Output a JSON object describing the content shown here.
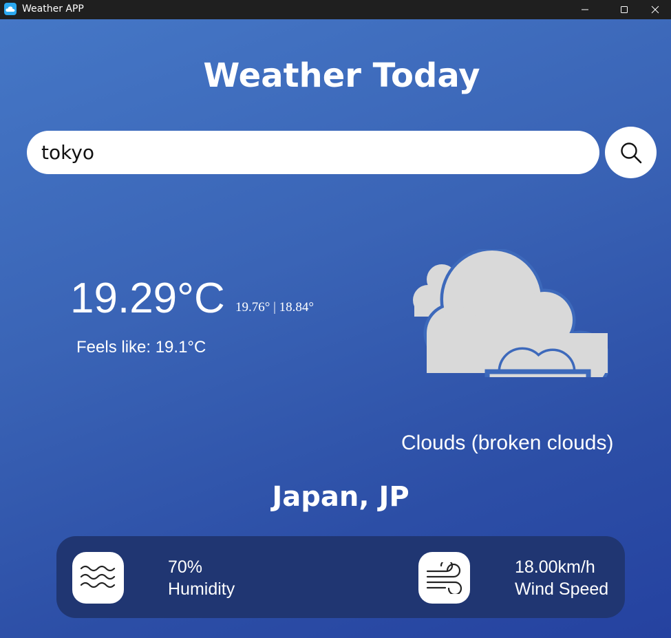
{
  "window": {
    "title": "Weather APP",
    "app_icon": "cloud-app-icon",
    "controls": [
      "minimize-icon",
      "maximize-icon",
      "close-icon"
    ]
  },
  "header": {
    "title": "Weather Today"
  },
  "search": {
    "value": "tokyo",
    "placeholder": "",
    "button_icon": "search-icon"
  },
  "current": {
    "temperature": "19.29°C",
    "range": "19.76° | 18.84°",
    "feels_like": "Feels like: 19.1°C",
    "condition_icon": "broken-clouds-icon",
    "description": "Clouds (broken clouds)",
    "location": "Japan, JP"
  },
  "stats": {
    "humidity": {
      "value": "70%",
      "label": "Humidity",
      "icon": "humidity-waves-icon"
    },
    "wind": {
      "value": "18.00km/h",
      "label": "Wind Speed",
      "icon": "wind-icon"
    }
  },
  "colors": {
    "background_top": "#4577c6",
    "background_bottom": "#2542a0",
    "card": "#203672",
    "cloud": "#d9d9d9",
    "titlebar": "#1f1f1f"
  }
}
